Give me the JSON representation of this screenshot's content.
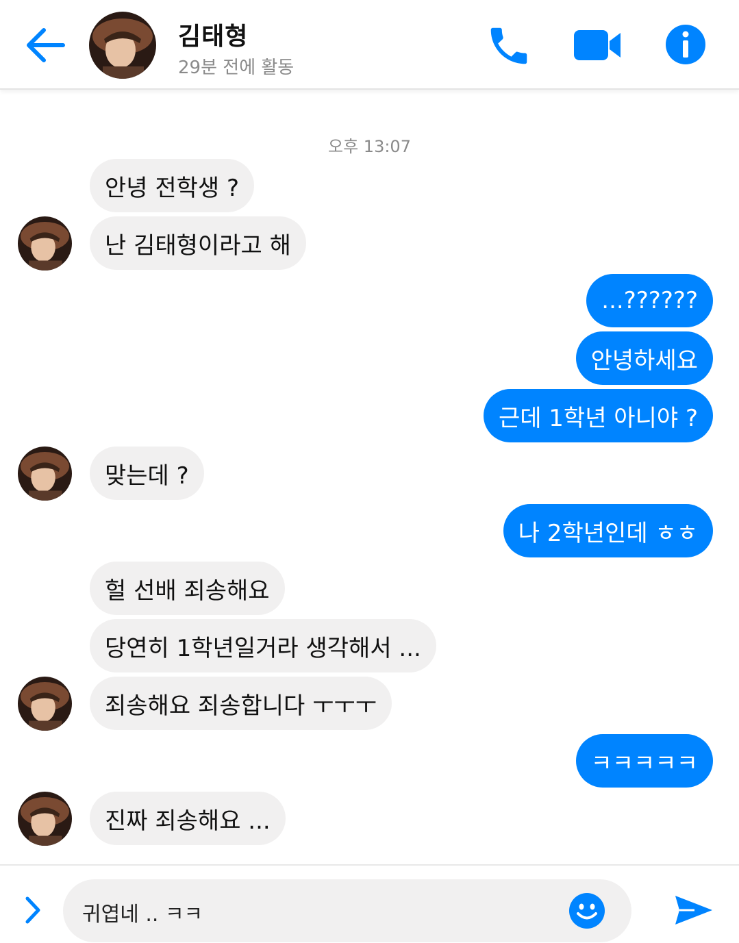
{
  "colors": {
    "accent": "#0084ff",
    "incoming_bubble": "#f1f0f0",
    "outgoing_text": "#ffffff"
  },
  "header": {
    "back_icon": "arrow-left-icon",
    "name": "김태형",
    "status": "29분 전에 활동",
    "actions": [
      {
        "icon": "phone-icon"
      },
      {
        "icon": "video-camera-icon"
      },
      {
        "icon": "info-icon"
      }
    ]
  },
  "conversation": {
    "timestamp": "오후 13:07",
    "messages": [
      {
        "from": "them",
        "text": "안녕 전학생 ?"
      },
      {
        "from": "them",
        "text": "난 김태형이라고 해"
      },
      {
        "from": "me",
        "text": "...??????"
      },
      {
        "from": "me",
        "text": "안녕하세요"
      },
      {
        "from": "me",
        "text": "근데 1학년 아니야 ?"
      },
      {
        "from": "them",
        "text": "맞는데 ?"
      },
      {
        "from": "me",
        "text": "나 2학년인데 ㅎㅎ"
      },
      {
        "from": "them",
        "text": "헐 선배 죄송해요"
      },
      {
        "from": "them",
        "text": "당연히 1학년일거라 생각해서 ..."
      },
      {
        "from": "them",
        "text": "죄송해요 죄송합니다 ㅜㅜㅜ"
      },
      {
        "from": "me",
        "text": "ㅋㅋㅋㅋㅋ"
      },
      {
        "from": "them",
        "text": "진짜 죄송해요 ..."
      }
    ]
  },
  "composer": {
    "expand_icon": "chevron-right-icon",
    "input_value": "귀엽네 .. ㅋㅋ",
    "emoji_icon": "smiley-icon",
    "send_icon": "send-icon"
  }
}
